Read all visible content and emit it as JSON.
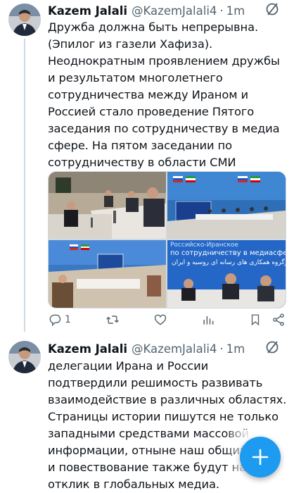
{
  "colors": {
    "accent": "#1d9bf0",
    "text": "#0f1419",
    "muted": "#536471"
  },
  "tweets": [
    {
      "name": "Kazem Jalali",
      "handle": "@KazemJalali4",
      "dot": "·",
      "time": "1m",
      "text": "Дружба должна быть непрерывна.\n(Эпилог из газели Хафиза).\nНеоднократным проявлением дружбы\nи результатом многолетнего\nсотрудничества между Ираном и\nРоссией стало проведение Пятого\nзаседания по сотрудничеству в медиа\nсфере. На пятом заседании по\nсотрудничеству в области СМИ",
      "media": {
        "photo4_banner_line1": "Российско-Иранское",
        "photo4_banner_line2": "по сотрудничеству в медиасфере",
        "photo4_banner_line3": "کارگروه همکاری های رسانه ای روسیه و ایران"
      },
      "actions": {
        "reply_count": "1"
      }
    },
    {
      "name": "Kazem Jalali",
      "handle": "@KazemJalali4",
      "dot": "·",
      "time": "1m",
      "text": "делегации Ирана и России\nподтвердили решимость развивать\nвзаимодействие в различных областях.\nСтраницы истории пишутся не только\nзападными средствами массовой\nинформации, отныне наш общий\nи повествование также будут на\nотклик в глобальных медиа."
    }
  ],
  "fab": {
    "icon": "plus-icon"
  }
}
